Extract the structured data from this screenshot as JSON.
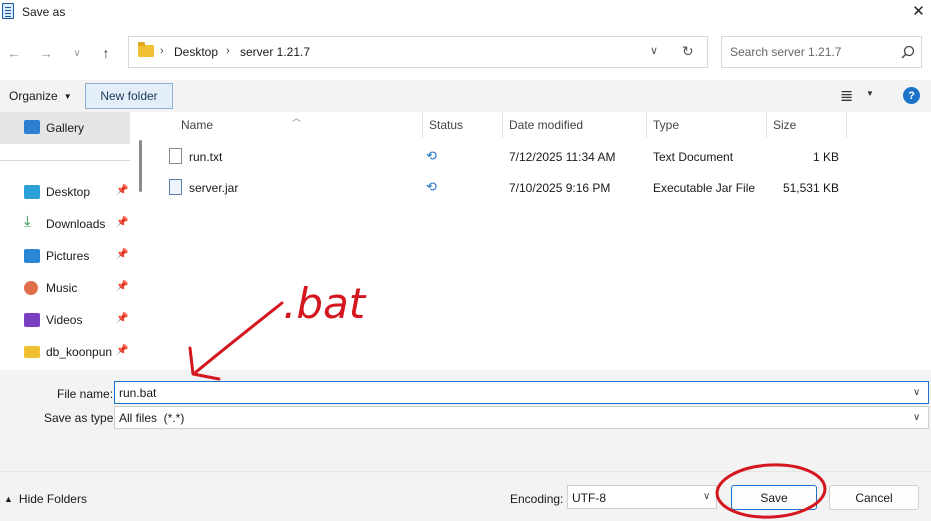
{
  "window": {
    "title": "Save as",
    "close_icon": "close-icon"
  },
  "nav": {
    "back_icon": "arrow-left-icon",
    "forward_icon": "arrow-right-icon",
    "recent_icon": "chevron-down-icon",
    "up_icon": "arrow-up-icon",
    "breadcrumb": [
      "Desktop",
      "server 1.21.7"
    ],
    "search_placeholder": "Search server 1.21.7"
  },
  "toolbar": {
    "organize_label": "Organize",
    "new_folder_label": "New folder"
  },
  "sidebar": {
    "gallery_label": "Gallery",
    "items": [
      {
        "label": "Desktop",
        "icon": "desktop-icon"
      },
      {
        "label": "Downloads",
        "icon": "download-icon"
      },
      {
        "label": "Pictures",
        "icon": "pictures-icon"
      },
      {
        "label": "Music",
        "icon": "music-icon"
      },
      {
        "label": "Videos",
        "icon": "videos-icon"
      },
      {
        "label": "db_koonpun",
        "icon": "folder-icon"
      }
    ]
  },
  "columns": {
    "name": "Name",
    "status": "Status",
    "date_modified": "Date modified",
    "type": "Type",
    "size": "Size"
  },
  "files": [
    {
      "name": "run.txt",
      "date": "7/12/2025 11:34 AM",
      "type": "Text Document",
      "size": "1 KB"
    },
    {
      "name": "server.jar",
      "date": "7/10/2025 9:16 PM",
      "type": "Executable Jar File",
      "size": "51,531 KB"
    }
  ],
  "form": {
    "file_name_label": "File name:",
    "file_name_value": "run.bat",
    "save_as_type_label": "Save as type:",
    "save_as_type_value": "All files  (*.*)"
  },
  "footer": {
    "hide_folders_label": "Hide Folders",
    "encoding_label": "Encoding:",
    "encoding_value": "UTF-8",
    "save_label": "Save",
    "cancel_label": "Cancel"
  },
  "annotation": {
    "text": ".bat",
    "color": "#d4161f"
  },
  "colors": {
    "accent": "#1d73c9",
    "chrome": "#f3f3f3",
    "folder": "#f0c032"
  }
}
